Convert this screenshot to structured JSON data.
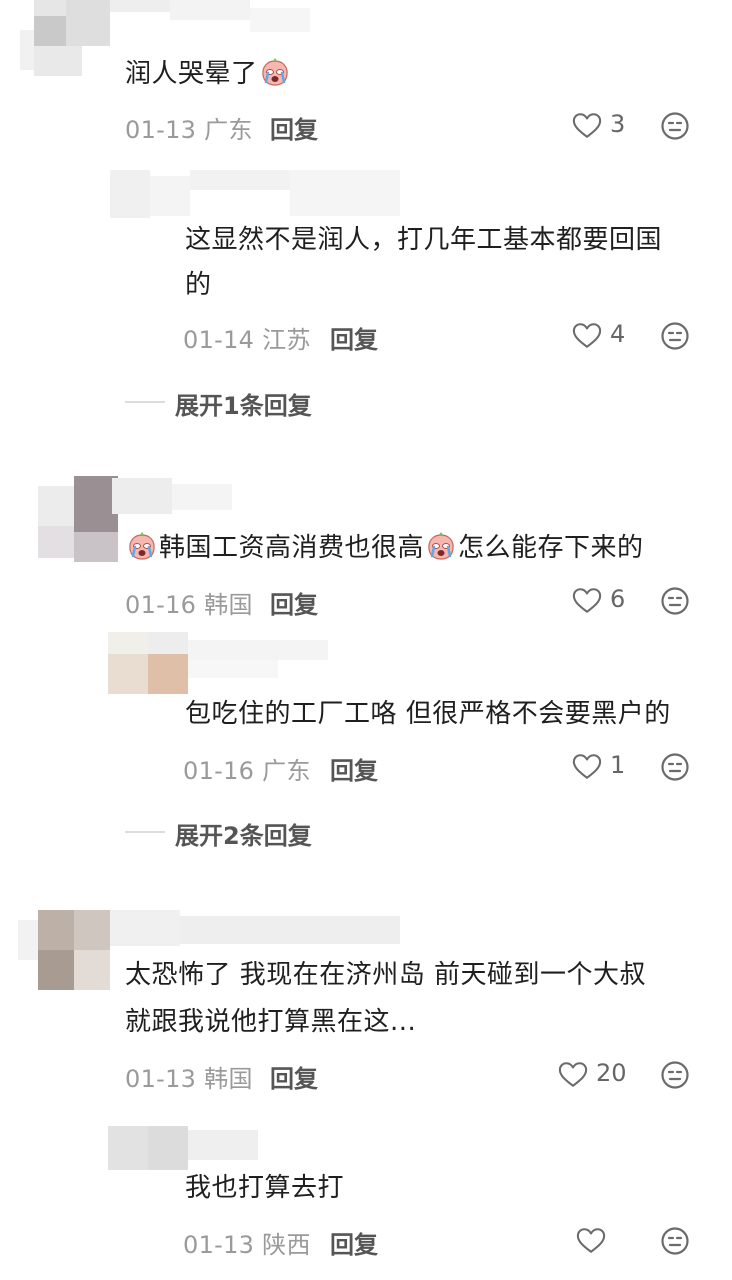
{
  "colors": {
    "text": "#1f1f1f",
    "meta": "#9a9a9a",
    "reply": "#555555",
    "icon": "#6b6b6b",
    "divider": "#dcdcdc"
  },
  "comments": [
    {
      "text_before": "润人哭晕了",
      "emoji_after": "crying-face-emoji",
      "date": "01-13 广东",
      "reply_label": "回复",
      "likes": "3",
      "replies": [
        {
          "text_line1": "这显然不是润人，打几年工基本都要回国",
          "text_line2": "的",
          "date": "01-14 江苏",
          "reply_label": "回复",
          "likes": "4"
        }
      ],
      "expand_label": "展开1条回复"
    },
    {
      "text_middle": "韩国工资高消费也很高",
      "text_after": "怎么能存下来的",
      "date": "01-16 韩国",
      "reply_label": "回复",
      "likes": "6",
      "replies": [
        {
          "text_line1": "包吃住的工厂工咯 但很严格不会要黑户的",
          "date": "01-16 广东",
          "reply_label": "回复",
          "likes": "1"
        }
      ],
      "expand_label": "展开2条回复"
    },
    {
      "text_line1": "太恐怖了 我现在在济州岛 前天碰到一个大叔",
      "text_line2": "就跟我说他打算黑在这...",
      "date": "01-13 韩国",
      "reply_label": "回复",
      "likes": "20",
      "replies": [
        {
          "text_line1": "我也打算去打",
          "date": "01-13 陕西",
          "reply_label": "回复",
          "likes": ""
        }
      ]
    }
  ]
}
